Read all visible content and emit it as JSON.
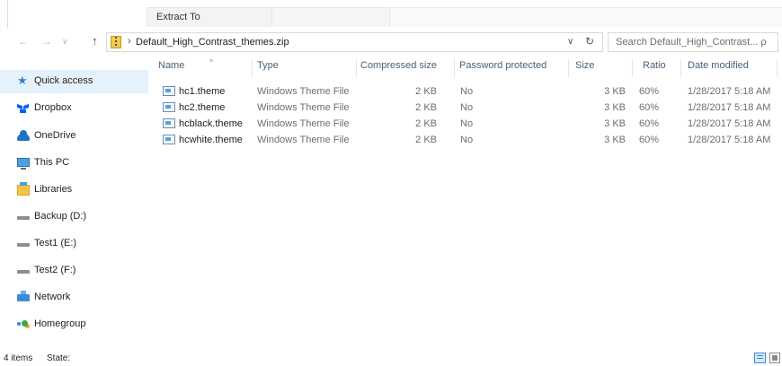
{
  "ribbon": {
    "tab_label": "Extract To"
  },
  "address": {
    "back_icon": "back-arrow-icon",
    "forward_icon": "forward-arrow-icon",
    "recent_icon": "recent-locations-chevron-icon",
    "up_icon": "up-arrow-icon",
    "path": "Default_High_Contrast_themes.zip",
    "search_placeholder": "Search Default_High_Contrast... ρ"
  },
  "nav": {
    "items": [
      {
        "label": "Quick access",
        "icon": "quick-access-star-icon"
      },
      {
        "label": "Dropbox",
        "icon": "dropbox-icon"
      },
      {
        "label": "OneDrive",
        "icon": "onedrive-cloud-icon"
      },
      {
        "label": "This PC",
        "icon": "this-pc-icon"
      },
      {
        "label": "Libraries",
        "icon": "libraries-icon"
      },
      {
        "label": "Backup (D:)",
        "icon": "drive-icon"
      },
      {
        "label": "Test1 (E:)",
        "icon": "drive-icon"
      },
      {
        "label": "Test2 (F:)",
        "icon": "drive-icon"
      },
      {
        "label": "Network",
        "icon": "network-icon"
      },
      {
        "label": "Homegroup",
        "icon": "homegroup-icon"
      }
    ]
  },
  "table": {
    "columns": {
      "name": "Name",
      "type": "Type",
      "compressed": "Compressed size",
      "password": "Password protected",
      "size": "Size",
      "ratio": "Ratio",
      "date": "Date modified"
    },
    "rows": [
      {
        "name": "hc1.theme",
        "type": "Windows Theme File",
        "compressed": "2 KB",
        "password": "No",
        "size": "3 KB",
        "ratio": "60%",
        "date": "1/28/2017 5:18 AM"
      },
      {
        "name": "hc2.theme",
        "type": "Windows Theme File",
        "compressed": "2 KB",
        "password": "No",
        "size": "3 KB",
        "ratio": "60%",
        "date": "1/28/2017 5:18 AM"
      },
      {
        "name": "hcblack.theme",
        "type": "Windows Theme File",
        "compressed": "2 KB",
        "password": "No",
        "size": "3 KB",
        "ratio": "60%",
        "date": "1/28/2017 5:18 AM"
      },
      {
        "name": "hcwhite.theme",
        "type": "Windows Theme File",
        "compressed": "2 KB",
        "password": "No",
        "size": "3 KB",
        "ratio": "60%",
        "date": "1/28/2017 5:18 AM"
      }
    ]
  },
  "status": {
    "item_count": "4 items",
    "state_label": "State:"
  },
  "colors": {
    "selection": "#e5f1fb",
    "header_text": "#4c607a",
    "accent": "#2b88d8"
  }
}
